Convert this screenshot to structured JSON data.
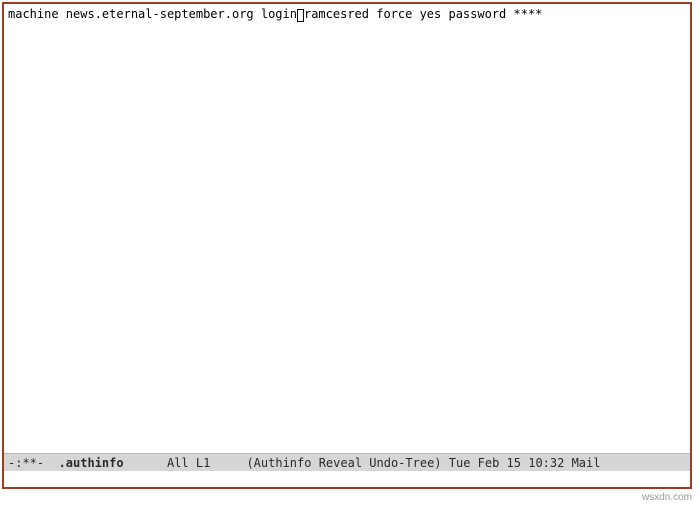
{
  "buffer": {
    "line1_a": "machine news.eternal-september.org login",
    "line1_b": "ramcesred force yes password ****"
  },
  "modeline": {
    "status": "-:**-  ",
    "buffer_name": ".authinfo",
    "gap1": "      ",
    "position": "All L1",
    "gap2": "     ",
    "modes": "(Authinfo Reveal Undo-Tree)",
    "time_mail": " Tue Feb 15 10:32 Mail"
  },
  "watermark": "wsxdn.com"
}
